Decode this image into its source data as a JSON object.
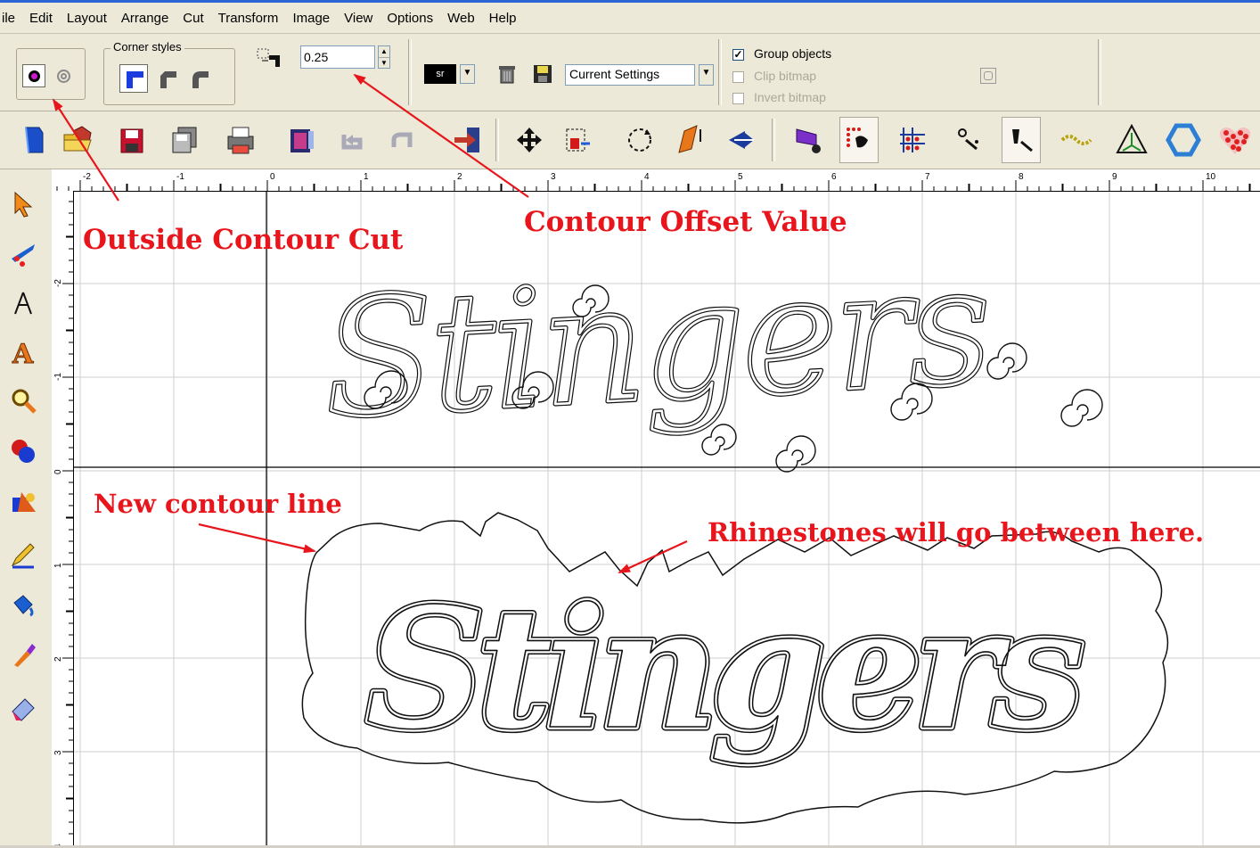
{
  "menu": [
    "ile",
    "Edit",
    "Layout",
    "Arrange",
    "Cut",
    "Transform",
    "Image",
    "View",
    "Options",
    "Web",
    "Help"
  ],
  "options_bar": {
    "corner_styles_label": "Corner styles",
    "offset_value": "0.25",
    "preset_tag": "sr",
    "settings_select": "Current Settings",
    "group_objects": {
      "label": "Group objects",
      "checked": true
    },
    "clip_bitmap": {
      "label": "Clip bitmap",
      "checked": false
    },
    "invert_bitmap": {
      "label": "Invert bitmap",
      "checked": false
    }
  },
  "toolbar_icons": [
    "new-file-icon",
    "open-folder-icon",
    "save-icon",
    "save-as-icon",
    "print-icon",
    "import-image-icon",
    "undo-icon",
    "redo-icon",
    "exit-icon",
    "move-icon",
    "resize-icon",
    "rotate-icon",
    "skew-icon",
    "mirror-icon",
    "shadow-icon",
    "rhinestone-grid-icon",
    "rhinestone-fill-icon",
    "rhinestone-path-icon",
    "rhinestone-pen-icon",
    "rhinestone-border-icon",
    "contour-triangle-icon",
    "hexagon-icon",
    "heart-rhinestone-icon"
  ],
  "toolbox_icons": [
    "select-arrow-icon",
    "knife-icon",
    "node-edit-icon",
    "text-tool-icon",
    "zoom-icon",
    "shapes-icon",
    "fill-tool-icon",
    "pencil-icon",
    "fill-bucket-icon",
    "eyedropper-icon",
    "eraser-icon"
  ],
  "ruler": {
    "horizontal": [
      "-2",
      "-1",
      "0",
      "1",
      "2",
      "3",
      "4",
      "5",
      "6",
      "7",
      "8",
      "9",
      "10"
    ],
    "vertical": [
      "-2",
      "-1",
      "0",
      "1",
      "2",
      "3",
      "4"
    ]
  },
  "canvas": {
    "design_text": "Stingers",
    "annotations": {
      "outside_contour": "Outside Contour Cut",
      "contour_offset": "Contour Offset Value",
      "new_contour": "New contour line",
      "rhinestones": "Rhinestones will go between here."
    }
  },
  "colors": {
    "annotation": "#e8161c",
    "chrome": "#ece9d8",
    "grid": "#cfcfcf",
    "title_bar": "#2c64d6"
  }
}
